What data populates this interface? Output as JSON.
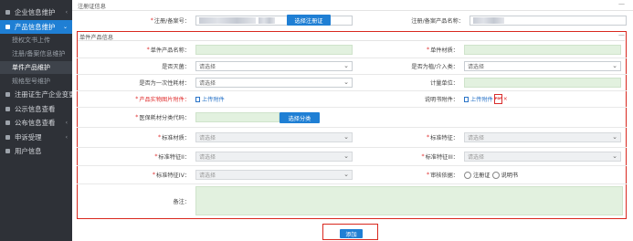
{
  "sidebar": {
    "items": [
      {
        "label": "企业信息维护",
        "chevron": "‹"
      },
      {
        "label": "产品信息维护",
        "chevron": "⌄"
      },
      {
        "label": "注册证生产企业变更",
        "chevron": ""
      },
      {
        "label": "公示信息查看",
        "chevron": ""
      },
      {
        "label": "公布信息查看",
        "chevron": "‹"
      },
      {
        "label": "申诉受理",
        "chevron": "‹"
      },
      {
        "label": "用户信息",
        "chevron": ""
      }
    ],
    "subitems": [
      "授权文书上传",
      "注册/备案信息维护",
      "单件产品维护",
      "规格型号维护"
    ]
  },
  "reg_section": {
    "title": "注册证信息",
    "collapse": "—",
    "reg_no_label": "注册/备案号：",
    "select_reg_button": "选择注册证",
    "product_name_label": "注册/备案产品名称："
  },
  "product_section": {
    "title": "单件产品信息",
    "collapse": "—",
    "fields": {
      "product_name": "单件产品名称：",
      "material": "单件材质：",
      "is_implant": "是否灭菌：",
      "is_intervention": "是否为植/介入类：",
      "is_disposable": "是否为一次性耗材：",
      "unit": "计量单位：",
      "product_image": "产品实物图片附件：",
      "manual": "说明书附件：",
      "category_code": "医保耗材分类代码：",
      "std_material": "标准材质：",
      "std_feature1": "标准特征：",
      "std_feature2": "标准特征II：",
      "std_feature3": "标准特征III：",
      "std_feature4": "标准特征IV：",
      "review_basis": "审核依据：",
      "remarks": "备注："
    },
    "select_placeholder": "请选择",
    "upload_label": "上传附件",
    "pdf_badge": "PDF",
    "pdf_close": "×",
    "select_category_button": "选择分类",
    "radio_options": [
      "注册证",
      "说明书"
    ]
  },
  "add_button": "添加",
  "colors": {
    "primary": "#1f7fd4",
    "required": "#e03030",
    "highlight_border": "#d9281e",
    "input_green": "#e2f1df"
  }
}
